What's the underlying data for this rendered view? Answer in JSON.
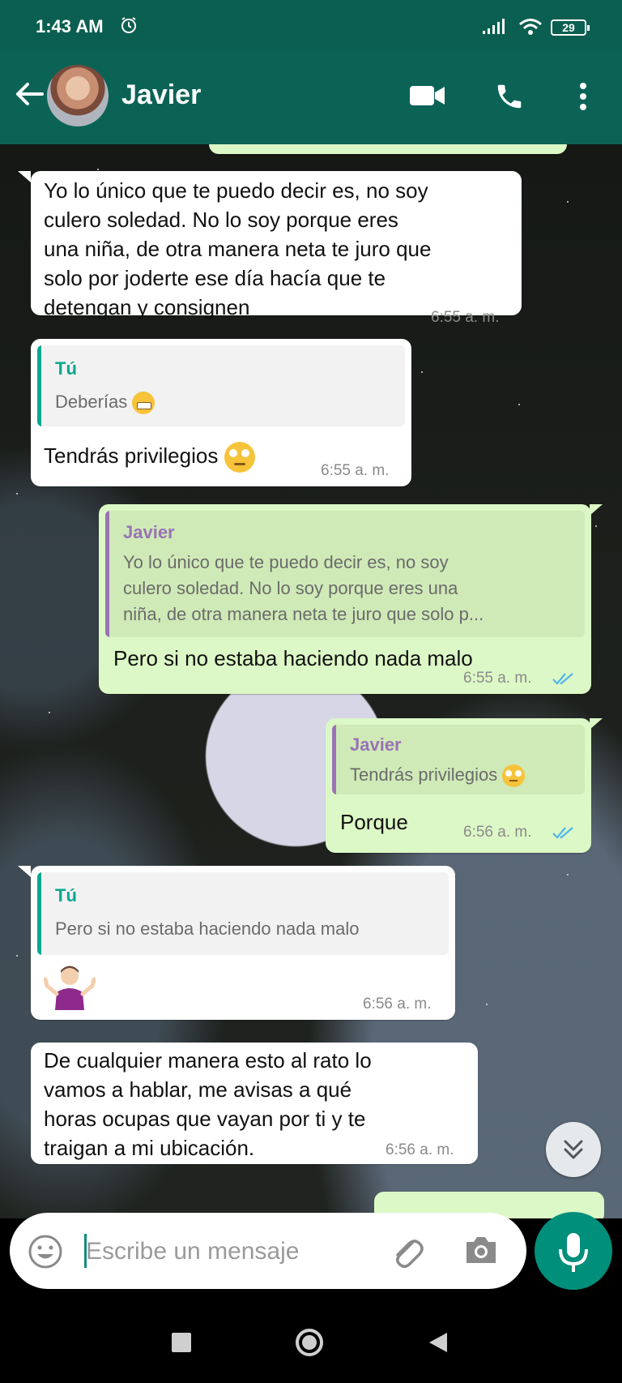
{
  "status_bar": {
    "time": "1:43 AM",
    "battery": "29"
  },
  "header": {
    "contact_name": "Javier"
  },
  "messages": [
    {
      "direction": "in",
      "lines": [
        "Yo lo único que te puedo decir es, no soy",
        "culero soledad. No lo soy porque eres",
        "una niña, de otra manera neta te juro que",
        "solo por joderte ese día hacía que te",
        "detengan y consignen"
      ],
      "time": "6:55 a. m."
    },
    {
      "direction": "in",
      "quote": {
        "author": "Tú",
        "text": "Deberías"
      },
      "text": "Tendrás privilegios",
      "time": "6:55 a. m."
    },
    {
      "direction": "out",
      "quote": {
        "author": "Javier",
        "lines": [
          "Yo lo único que te puedo decir es, no soy",
          "culero soledad. No lo soy porque eres una",
          "niña, de otra manera neta te juro que solo p..."
        ]
      },
      "text": "Pero si no estaba haciendo nada malo",
      "time": "6:55 a. m."
    },
    {
      "direction": "out",
      "quote": {
        "author": "Javier",
        "text": "Tendrás privilegios"
      },
      "text": "Porque",
      "time": "6:56 a. m."
    },
    {
      "direction": "in",
      "quote": {
        "author": "Tú",
        "text": "Pero si no estaba haciendo nada malo"
      },
      "emoji": "person-shrugging",
      "time": "6:56 a. m."
    },
    {
      "direction": "in",
      "lines": [
        "De cualquier manera esto al rato lo",
        "vamos a hablar, me avisas a qué",
        "horas ocupas que vayan por ti y te",
        "traigan a mi ubicación."
      ],
      "time": "6:56 a. m."
    }
  ],
  "composer": {
    "placeholder": "Escribe un mensaje"
  },
  "colors": {
    "header": "#0b6356",
    "status_bar": "#0b5f50",
    "incoming": "#ffffff",
    "outgoing": "#dcf8c6",
    "accent": "#008f7a",
    "quote_green": "#06a88f",
    "quote_purple": "#9a73b6",
    "read_ticks": "#4fb6ec"
  }
}
